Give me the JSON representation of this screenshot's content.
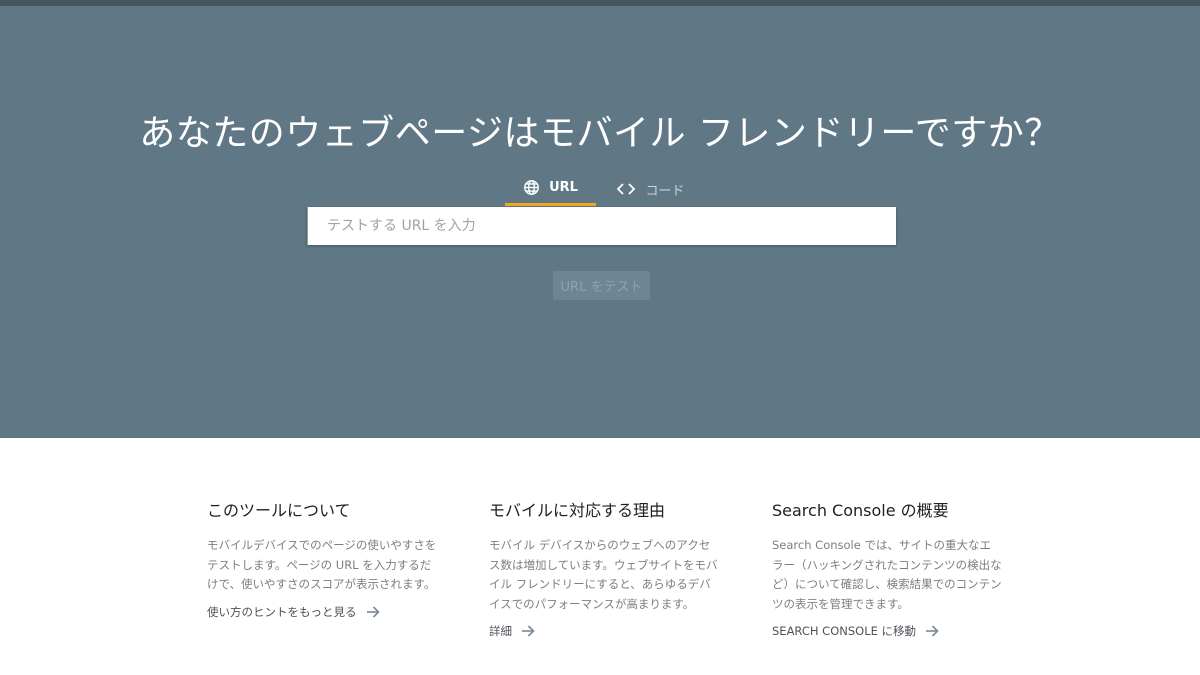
{
  "hero": {
    "title": "あなたのウェブページはモバイル フレンドリーですか？",
    "tabs": [
      {
        "label": "URL",
        "icon": "globe-icon",
        "active": true
      },
      {
        "label": "コード",
        "icon": "code-icon",
        "active": false
      }
    ],
    "url_input": {
      "placeholder": "テストする URL を入力",
      "value": ""
    },
    "test_button_label": "URL をテスト"
  },
  "info_sections": [
    {
      "title": "このツールについて",
      "body": "モバイルデバイスでのページの使いやすさをテストします。ページの URL を入力するだけで、使いやすさのスコアが表示されます。",
      "link": "使い方のヒントをもっと見る"
    },
    {
      "title": "モバイルに対応する理由",
      "body": "モバイル デバイスからのウェブへのアクセス数は増加しています。ウェブサイトをモバイル フレンドリーにすると、あらゆるデバイスでのパフォーマンスが高まります。",
      "link": "詳細"
    },
    {
      "title": "Search Console の概要",
      "body": "Search Console では、サイトの重大なエラー（ハッキングされたコンテンツの検出など）について確認し、検索結果でのコンテンツの表示を管理できます。",
      "link": "SEARCH CONSOLE に移動"
    }
  ],
  "colors": {
    "hero_bg": "#607886",
    "tab_indicator": "#f5a623"
  }
}
